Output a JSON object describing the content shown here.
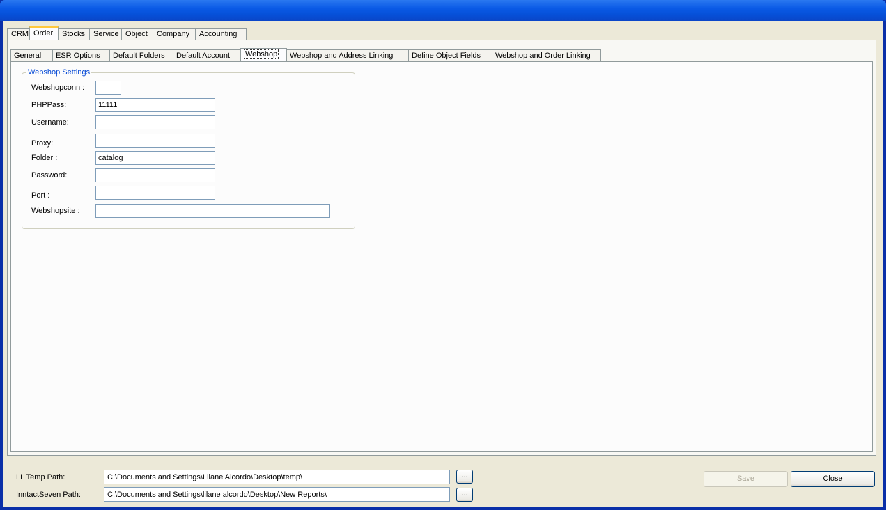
{
  "outer_tabs": [
    {
      "label": "CRM"
    },
    {
      "label": "Order"
    },
    {
      "label": "Stocks"
    },
    {
      "label": "Service"
    },
    {
      "label": "Object"
    },
    {
      "label": "Company"
    },
    {
      "label": "Accounting"
    }
  ],
  "inner_tabs": [
    {
      "label": "General"
    },
    {
      "label": "ESR Options"
    },
    {
      "label": "Default Folders"
    },
    {
      "label": "Default Account"
    },
    {
      "label": "Webshop"
    },
    {
      "label": "Webshop and Address Linking"
    },
    {
      "label": "Define Object Fields"
    },
    {
      "label": "Webshop and Order Linking"
    }
  ],
  "webshop": {
    "group_title": "Webshop Settings",
    "fields": {
      "webshopconn": {
        "label": "Webshopconn :",
        "value": ""
      },
      "phppass": {
        "label": "PHPPass:",
        "value": "11111"
      },
      "username": {
        "label": "Username:",
        "value": ""
      },
      "proxy": {
        "label": "Proxy:",
        "value": ""
      },
      "folder": {
        "label": "Folder :",
        "value": "catalog"
      },
      "password": {
        "label": "Password:",
        "value": ""
      },
      "port": {
        "label": "Port :",
        "value": ""
      },
      "webshopsite": {
        "label": "Webshopsite :",
        "value": ""
      }
    }
  },
  "paths": {
    "ll_temp": {
      "label": "LL Temp Path:",
      "value": "C:\\Documents and Settings\\Lilane Alcordo\\Desktop\\temp\\"
    },
    "inntact": {
      "label": "InntactSeven Path:",
      "value": "C:\\Documents and Settings\\lilane alcordo\\Desktop\\New Reports\\"
    },
    "browse_label": "..."
  },
  "buttons": {
    "save": "Save",
    "close": "Close"
  }
}
